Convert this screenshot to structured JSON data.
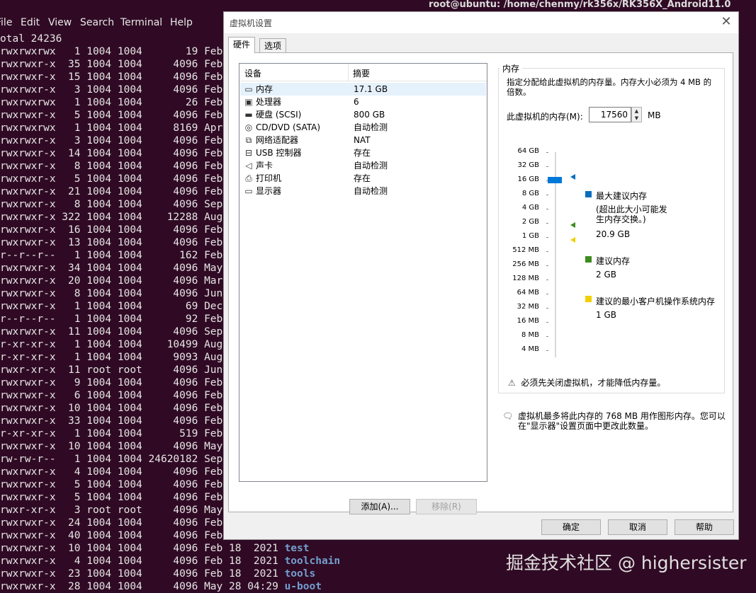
{
  "terminal": {
    "title": "root@ubuntu: /home/chenmy/rk356x/RK356X_Android11.0",
    "menu": [
      "File",
      "Edit",
      "View",
      "Search",
      "Terminal",
      "Help"
    ],
    "lines": [
      "otal 24236",
      "rwxrwxrwx   1 1004 1004       19 Feb",
      "rwxrwxr-x  35 1004 1004     4096 Feb",
      "rwxrwxr-x  15 1004 1004     4096 Feb",
      "rwxrwxr-x   3 1004 1004     4096 Feb",
      "rwxrwxrwx   1 1004 1004       26 Feb",
      "rwxrwxr-x   5 1004 1004     4096 Feb",
      "rwxrwxrwx   1 1004 1004     8169 Apr",
      "rwxrwxr-x   3 1004 1004     4096 Feb",
      "rwxrwxr-x  14 1004 1004     4096 Feb",
      "rwxrwxr-x   8 1004 1004     4096 Feb",
      "rwxrwxr-x   5 1004 1004     4096 Feb",
      "rwxrwxr-x  21 1004 1004     4096 Feb",
      "rwxrwxr-x   8 1004 1004     4096 Sep",
      "rwxrwxr-x 322 1004 1004    12288 Aug",
      "rwxrwxr-x  16 1004 1004     4096 Feb",
      "rwxrwxr-x  13 1004 1004     4096 Feb",
      "r--r--r--   1 1004 1004      162 Feb",
      "rwxrwxr-x  34 1004 1004     4096 May",
      "rwxrwxr-x  20 1004 1004     4096 Mar",
      "rwxrwxr-x   8 1004 1004     4096 Jun",
      "rwxrwxr-x   1 1004 1004       69 Dec",
      "r--r--r--   1 1004 1004       92 Feb",
      "rwxrwxr-x  11 1004 1004     4096 Sep",
      "r-xr-xr-x   1 1004 1004    10499 Aug",
      "r-xr-xr-x   1 1004 1004     9093 Aug",
      "rwxr-xr-x  11 root root     4096 Jun",
      "rwxrwxr-x   9 1004 1004     4096 Feb",
      "rwxrwxr-x   6 1004 1004     4096 Feb",
      "rwxrwxr-x  10 1004 1004     4096 Feb",
      "rwxrwxr-x  33 1004 1004     4096 Feb",
      "r-xr-xr-x   1 1004 1004      519 Feb",
      "rwxrwxr-x  10 1004 1004     4096 May",
      "rw-rw-r--   1 1004 1004 24620182 Sep",
      "rwxrwxr-x   4 1004 1004     4096 Feb",
      "rwxrwxr-x   5 1004 1004     4096 Feb",
      "rwxrwxr-x   5 1004 1004     4096 Feb",
      "rwxr-xr-x   3 root root     4096 May",
      "rwxrwxr-x  24 1004 1004     4096 Feb",
      "rwxrwxr-x  40 1004 1004     4096 Feb",
      "rwxrwxr-x  10 1004 1004     4096 Feb 18  2021 ",
      "rwxrwxr-x   4 1004 1004     4096 Feb 18  2021 ",
      "rwxrwxr-x  23 1004 1004     4096 Feb 18  2021 ",
      "rwxrwxr-x  28 1004 1004     4096 May 28 04:29 "
    ],
    "names": {
      "40": "test",
      "41": "toolchain",
      "42": "tools",
      "43": "u-boot"
    }
  },
  "dialog": {
    "title": "虚拟机设置",
    "tabs": {
      "hardware": "硬件",
      "options": "选项"
    },
    "device_list": {
      "col_device": "设备",
      "col_summary": "摘要",
      "devices": [
        {
          "icon": "memory-icon",
          "glyph": "▭",
          "name": "内存",
          "summary": "17.1 GB"
        },
        {
          "icon": "processor-icon",
          "glyph": "▣",
          "name": "处理器",
          "summary": "6"
        },
        {
          "icon": "harddisk-icon",
          "glyph": "▬",
          "name": "硬盘 (SCSI)",
          "summary": "800 GB"
        },
        {
          "icon": "cdrom-icon",
          "glyph": "◎",
          "name": "CD/DVD (SATA)",
          "summary": "自动检测"
        },
        {
          "icon": "network-icon",
          "glyph": "⧉",
          "name": "网络适配器",
          "summary": "NAT"
        },
        {
          "icon": "usb-icon",
          "glyph": "⊟",
          "name": "USB 控制器",
          "summary": "存在"
        },
        {
          "icon": "sound-icon",
          "glyph": "◁",
          "name": "声卡",
          "summary": "自动检测"
        },
        {
          "icon": "printer-icon",
          "glyph": "⎙",
          "name": "打印机",
          "summary": "存在"
        },
        {
          "icon": "display-icon",
          "glyph": "▭",
          "name": "显示器",
          "summary": "自动检测"
        }
      ]
    },
    "add_button": "添加(A)...",
    "remove_button": "移除(R)",
    "memory": {
      "group_title": "内存",
      "description": "指定分配给此虚拟机的内存量。内存大小必须为 4 MB 的倍数。",
      "label": "此虚拟机的内存(M):",
      "value": "17560",
      "unit": "MB",
      "scale_labels": [
        "64 GB",
        "32 GB",
        "16 GB",
        "8 GB",
        "4 GB",
        "2 GB",
        "1 GB",
        "512 MB",
        "256 MB",
        "128 MB",
        "64 MB",
        "32 MB",
        "16 MB",
        "8 MB",
        "4 MB"
      ],
      "legend": {
        "max_title": "最大建议内存",
        "max_note": "(超出此大小可能发生内存交换。)",
        "max_value": "20.9 GB",
        "rec_title": "建议内存",
        "rec_value": "2 GB",
        "min_title": "建议的最小客户机操作系统内存",
        "min_value": "1 GB"
      },
      "colors": {
        "max": "#0a6ebd",
        "rec": "#3c8c1e",
        "min": "#f0d000",
        "thumb": "#0078d7"
      },
      "warning": "必须先关闭虚拟机，才能降低内存量。"
    },
    "note": "虚拟机最多将此内存的 768 MB 用作图形内存。您可以在\"显示器\"设置页面中更改此数量。",
    "ok_button": "确定",
    "cancel_button": "取消",
    "help_button": "帮助"
  },
  "watermark": "掘金技术社区 @ highersister"
}
